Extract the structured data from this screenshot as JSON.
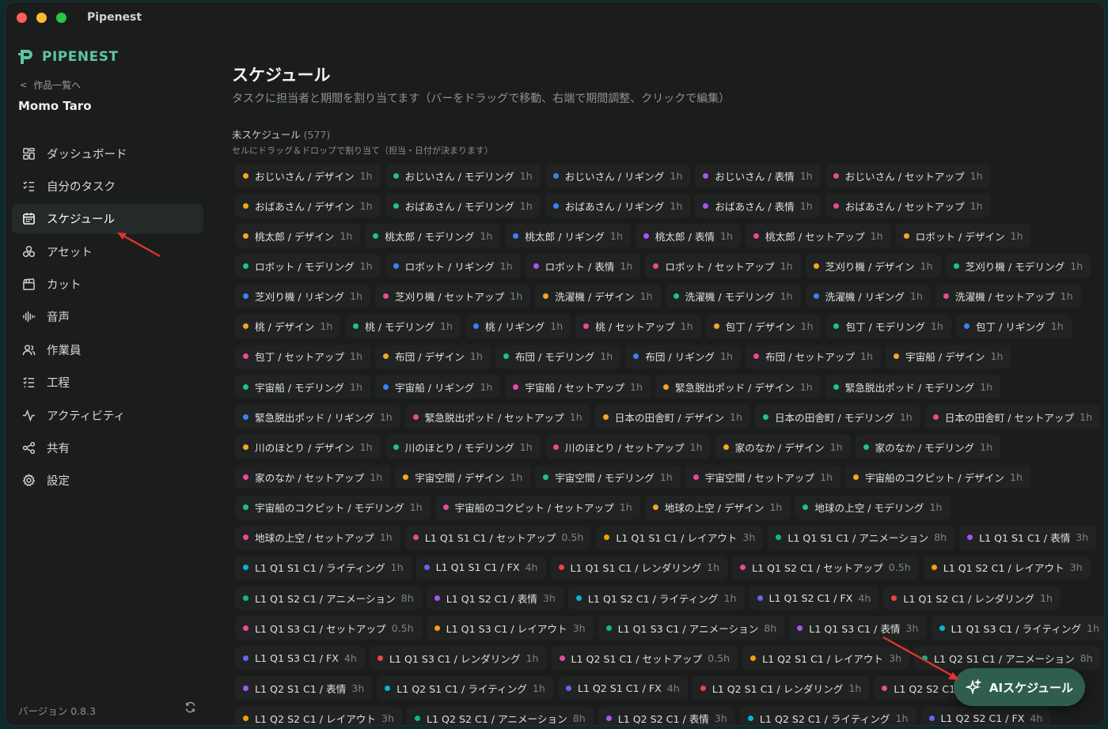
{
  "window": {
    "title": "Pipenest"
  },
  "sidebar": {
    "logo_text": "PIPENEST",
    "back_label": "作品一覧へ",
    "project_name": "Momo Taro",
    "items": [
      {
        "label": "ダッシュボード",
        "icon": "dashboard-icon"
      },
      {
        "label": "自分のタスク",
        "icon": "task-list-icon"
      },
      {
        "label": "スケジュール",
        "icon": "calendar-icon",
        "active": true
      },
      {
        "label": "アセット",
        "icon": "assets-icon"
      },
      {
        "label": "カット",
        "icon": "clapperboard-icon"
      },
      {
        "label": "音声",
        "icon": "audio-wave-icon"
      },
      {
        "label": "作業員",
        "icon": "users-icon"
      },
      {
        "label": "工程",
        "icon": "checklist-icon"
      },
      {
        "label": "アクティビティ",
        "icon": "activity-icon"
      },
      {
        "label": "共有",
        "icon": "share-icon"
      },
      {
        "label": "設定",
        "icon": "gear-icon"
      }
    ],
    "version": "バージョン 0.8.3"
  },
  "main": {
    "title": "スケジュール",
    "subtitle": "タスクに担当者と期間を割り当てます（バーをドラッグで移動、右端で期間調整、クリックで編集）",
    "unscheduled_label": "未スケジュール",
    "unscheduled_count": "(577)",
    "hint": "セルにドラッグ＆ドロップで割り当て（担当・日付が決まります）"
  },
  "chip_rows": [
    [
      [
        "おじいさん / デザイン",
        "1h",
        "design"
      ],
      [
        "おじいさん / モデリング",
        "1h",
        "model"
      ],
      [
        "おじいさん / リギング",
        "1h",
        "rig"
      ],
      [
        "おじいさん / 表情",
        "1h",
        "face"
      ],
      [
        "おじいさん / セットアップ",
        "1h",
        "setup"
      ]
    ],
    [
      [
        "おばあさん / デザイン",
        "1h",
        "design"
      ],
      [
        "おばあさん / モデリング",
        "1h",
        "model"
      ],
      [
        "おばあさん / リギング",
        "1h",
        "rig"
      ],
      [
        "おばあさん / 表情",
        "1h",
        "face"
      ],
      [
        "おばあさん / セットアップ",
        "1h",
        "setup"
      ]
    ],
    [
      [
        "桃太郎 / デザイン",
        "1h",
        "design"
      ],
      [
        "桃太郎 / モデリング",
        "1h",
        "model"
      ],
      [
        "桃太郎 / リギング",
        "1h",
        "rig"
      ],
      [
        "桃太郎 / 表情",
        "1h",
        "face"
      ],
      [
        "桃太郎 / セットアップ",
        "1h",
        "setup"
      ],
      [
        "ロボット / デザイン",
        "1h",
        "design"
      ]
    ],
    [
      [
        "ロボット / モデリング",
        "1h",
        "model"
      ],
      [
        "ロボット / リギング",
        "1h",
        "rig"
      ],
      [
        "ロボット / 表情",
        "1h",
        "face"
      ],
      [
        "ロボット / セットアップ",
        "1h",
        "setup"
      ],
      [
        "芝刈り機 / デザイン",
        "1h",
        "design"
      ],
      [
        "芝刈り機 / モデリング",
        "1h",
        "model"
      ]
    ],
    [
      [
        "芝刈り機 / リギング",
        "1h",
        "rig"
      ],
      [
        "芝刈り機 / セットアップ",
        "1h",
        "setup"
      ],
      [
        "洗濯機 / デザイン",
        "1h",
        "design"
      ],
      [
        "洗濯機 / モデリング",
        "1h",
        "model"
      ],
      [
        "洗濯機 / リギング",
        "1h",
        "rig"
      ],
      [
        "洗濯機 / セットアップ",
        "1h",
        "setup"
      ]
    ],
    [
      [
        "桃 / デザイン",
        "1h",
        "design"
      ],
      [
        "桃 / モデリング",
        "1h",
        "model"
      ],
      [
        "桃 / リギング",
        "1h",
        "rig"
      ],
      [
        "桃 / セットアップ",
        "1h",
        "setup"
      ],
      [
        "包丁 / デザイン",
        "1h",
        "design"
      ],
      [
        "包丁 / モデリング",
        "1h",
        "model"
      ],
      [
        "包丁 / リギング",
        "1h",
        "rig"
      ]
    ],
    [
      [
        "包丁 / セットアップ",
        "1h",
        "setup"
      ],
      [
        "布団 / デザイン",
        "1h",
        "design"
      ],
      [
        "布団 / モデリング",
        "1h",
        "model"
      ],
      [
        "布団 / リギング",
        "1h",
        "rig"
      ],
      [
        "布団 / セットアップ",
        "1h",
        "setup"
      ],
      [
        "宇宙船 / デザイン",
        "1h",
        "design"
      ]
    ],
    [
      [
        "宇宙船 / モデリング",
        "1h",
        "model"
      ],
      [
        "宇宙船 / リギング",
        "1h",
        "rig"
      ],
      [
        "宇宙船 / セットアップ",
        "1h",
        "setup"
      ],
      [
        "緊急脱出ポッド / デザイン",
        "1h",
        "design"
      ],
      [
        "緊急脱出ポッド / モデリング",
        "1h",
        "model"
      ]
    ],
    [
      [
        "緊急脱出ポッド / リギング",
        "1h",
        "rig"
      ],
      [
        "緊急脱出ポッド / セットアップ",
        "1h",
        "setup"
      ],
      [
        "日本の田舎町 / デザイン",
        "1h",
        "design"
      ],
      [
        "日本の田舎町 / モデリング",
        "1h",
        "model"
      ],
      [
        "日本の田舎町 / セットアップ",
        "1h",
        "setup"
      ]
    ],
    [
      [
        "川のほとり / デザイン",
        "1h",
        "design"
      ],
      [
        "川のほとり / モデリング",
        "1h",
        "model"
      ],
      [
        "川のほとり / セットアップ",
        "1h",
        "setup"
      ],
      [
        "家のなか / デザイン",
        "1h",
        "design"
      ],
      [
        "家のなか / モデリング",
        "1h",
        "model"
      ]
    ],
    [
      [
        "家のなか / セットアップ",
        "1h",
        "setup"
      ],
      [
        "宇宙空間 / デザイン",
        "1h",
        "design"
      ],
      [
        "宇宙空間 / モデリング",
        "1h",
        "model"
      ],
      [
        "宇宙空間 / セットアップ",
        "1h",
        "setup"
      ],
      [
        "宇宙船のコクピット / デザイン",
        "1h",
        "design"
      ]
    ],
    [
      [
        "宇宙船のコクピット / モデリング",
        "1h",
        "model"
      ],
      [
        "宇宙船のコクピット / セットアップ",
        "1h",
        "setup"
      ],
      [
        "地球の上空 / デザイン",
        "1h",
        "design"
      ],
      [
        "地球の上空 / モデリング",
        "1h",
        "model"
      ]
    ],
    [
      [
        "地球の上空 / セットアップ",
        "1h",
        "setup"
      ],
      [
        "L1 Q1 S1 C1 / セットアップ",
        "0.5h",
        "setup"
      ],
      [
        "L1 Q1 S1 C1 / レイアウト",
        "3h",
        "layout"
      ],
      [
        "L1 Q1 S1 C1 / アニメーション",
        "8h",
        "anim"
      ],
      [
        "L1 Q1 S1 C1 / 表情",
        "3h",
        "face"
      ]
    ],
    [
      [
        "L1 Q1 S1 C1 / ライティング",
        "1h",
        "light"
      ],
      [
        "L1 Q1 S1 C1 / FX",
        "4h",
        "fx"
      ],
      [
        "L1 Q1 S1 C1 / レンダリング",
        "1h",
        "render"
      ],
      [
        "L1 Q1 S2 C1 / セットアップ",
        "0.5h",
        "setup"
      ],
      [
        "L1 Q1 S2 C1 / レイアウト",
        "3h",
        "layout"
      ]
    ],
    [
      [
        "L1 Q1 S2 C1 / アニメーション",
        "8h",
        "anim"
      ],
      [
        "L1 Q1 S2 C1 / 表情",
        "3h",
        "face"
      ],
      [
        "L1 Q1 S2 C1 / ライティング",
        "1h",
        "light"
      ],
      [
        "L1 Q1 S2 C1 / FX",
        "4h",
        "fx"
      ],
      [
        "L1 Q1 S2 C1 / レンダリング",
        "1h",
        "render"
      ]
    ],
    [
      [
        "L1 Q1 S3 C1 / セットアップ",
        "0.5h",
        "setup"
      ],
      [
        "L1 Q1 S3 C1 / レイアウト",
        "3h",
        "layout"
      ],
      [
        "L1 Q1 S3 C1 / アニメーション",
        "8h",
        "anim"
      ],
      [
        "L1 Q1 S3 C1 / 表情",
        "3h",
        "face"
      ],
      [
        "L1 Q1 S3 C1 / ライティング",
        "1h",
        "light"
      ]
    ],
    [
      [
        "L1 Q1 S3 C1 / FX",
        "4h",
        "fx"
      ],
      [
        "L1 Q1 S3 C1 / レンダリング",
        "1h",
        "render"
      ],
      [
        "L1 Q2 S1 C1 / セットアップ",
        "0.5h",
        "setup"
      ],
      [
        "L1 Q2 S1 C1 / レイアウト",
        "3h",
        "layout"
      ],
      [
        "L1 Q2 S1 C1 / アニメーション",
        "8h",
        "anim"
      ]
    ],
    [
      [
        "L1 Q2 S1 C1 / 表情",
        "3h",
        "face"
      ],
      [
        "L1 Q2 S1 C1 / ライティング",
        "1h",
        "light"
      ],
      [
        "L1 Q2 S1 C1 / FX",
        "4h",
        "fx"
      ],
      [
        "L1 Q2 S1 C1 / レンダリング",
        "1h",
        "render"
      ],
      [
        "L1 Q2 S2 C1 / セ",
        "",
        "setup"
      ]
    ],
    [
      [
        "L1 Q2 S2 C1 / レイアウト",
        "3h",
        "layout"
      ],
      [
        "L1 Q2 S2 C1 / アニメーション",
        "8h",
        "anim"
      ],
      [
        "L1 Q2 S2 C1 / 表情",
        "3h",
        "face"
      ],
      [
        "L1 Q2 S2 C1 / ライティング",
        "1h",
        "light"
      ],
      [
        "L1 Q2 S2 C1 / FX",
        "4h",
        "fx"
      ]
    ]
  ],
  "ai_button": {
    "label": "AIスケジュール",
    "icon": "sparkles-icon"
  },
  "colors": {
    "accent": "#5fc4a4",
    "design": "#f5a623",
    "model": "#22c08b",
    "rig": "#3b82f6",
    "face": "#a855f7",
    "setup": "#ec4899",
    "layout": "#f59e0b",
    "anim": "#10b981",
    "light": "#06b6d4",
    "fx": "#6366f1",
    "render": "#ef4444",
    "annotation_arrow": "#e0352b"
  }
}
